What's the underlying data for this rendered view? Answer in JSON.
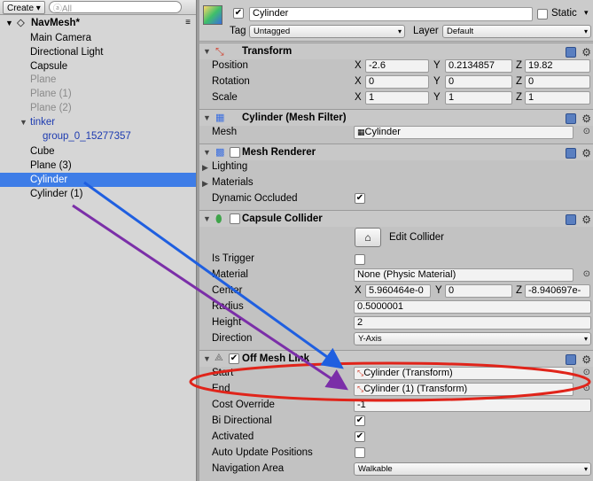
{
  "hierarchy": {
    "create_label": "Create",
    "search_placeholder": "ⓐAll",
    "scene_name": "NavMesh*",
    "items": [
      {
        "label": "Main Camera"
      },
      {
        "label": "Directional Light"
      },
      {
        "label": "Capsule"
      },
      {
        "label": "Plane"
      },
      {
        "label": "Plane (1)"
      },
      {
        "label": "Plane (2)"
      },
      {
        "label": "tinker"
      },
      {
        "label": "group_0_15277357"
      },
      {
        "label": "Cube"
      },
      {
        "label": "Plane (3)"
      },
      {
        "label": "Cylinder"
      },
      {
        "label": "Cylinder (1)"
      }
    ]
  },
  "inspector": {
    "object_name": "Cylinder",
    "static_label": "Static",
    "tag_label": "Tag",
    "tag_value": "Untagged",
    "layer_label": "Layer",
    "layer_value": "Default",
    "transform": {
      "title": "Transform",
      "position_label": "Position",
      "position": [
        "-2.6",
        "0.2134857",
        "19.82"
      ],
      "rotation_label": "Rotation",
      "rotation": [
        "0",
        "0",
        "0"
      ],
      "scale_label": "Scale",
      "scale": [
        "1",
        "1",
        "1"
      ],
      "axes": [
        "X",
        "Y",
        "Z"
      ]
    },
    "mesh_filter": {
      "title": "Cylinder (Mesh Filter)",
      "mesh_label": "Mesh",
      "mesh_value": "Cylinder"
    },
    "mesh_renderer": {
      "title": "Mesh Renderer",
      "lighting": "Lighting",
      "materials": "Materials",
      "dynamic_occluded": "Dynamic Occluded"
    },
    "capsule_collider": {
      "title": "Capsule Collider",
      "edit_collider": "Edit Collider",
      "is_trigger": "Is Trigger",
      "material_label": "Material",
      "material_value": "None (Physic Material)",
      "center_label": "Center",
      "center": [
        "5.960464e-0",
        "0",
        "-8.940697e-"
      ],
      "radius_label": "Radius",
      "radius": "0.5000001",
      "height_label": "Height",
      "height": "2",
      "direction_label": "Direction",
      "direction": "Y-Axis"
    },
    "off_mesh_link": {
      "title": "Off Mesh Link",
      "start_label": "Start",
      "start_value": "Cylinder (Transform)",
      "end_label": "End",
      "end_value": "Cylinder (1) (Transform)",
      "cost_label": "Cost Override",
      "cost_value": "-1",
      "bidir_label": "Bi Directional",
      "activated_label": "Activated",
      "auto_update_label": "Auto Update Positions",
      "nav_area_label": "Navigation Area",
      "nav_area_value": "Walkable"
    }
  },
  "annotation_colors": {
    "blue_arrow": "#1f5fe0",
    "purple_arrow": "#7b2fa8",
    "red_ellipse": "#e0241a"
  }
}
